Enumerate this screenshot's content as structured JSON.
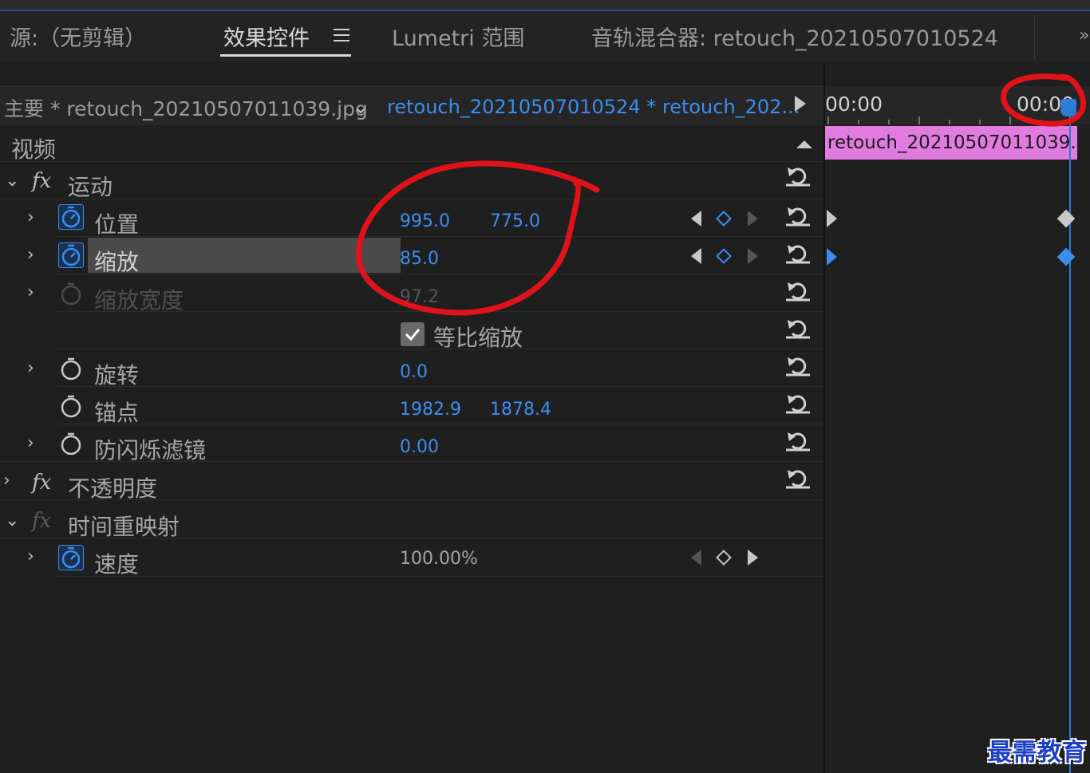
{
  "tabs": [
    {
      "label": "源:（无剪辑）"
    },
    {
      "label": "效果控件"
    },
    {
      "label": "Lumetri 范围"
    },
    {
      "label": "音轨混合器: retouch_20210507010524"
    }
  ],
  "clip_bar": {
    "master": "主要 * retouch_20210507011039.jpg",
    "sequence": "retouch_20210507010524 * retouch_202..."
  },
  "section": {
    "video": "视频"
  },
  "effects": {
    "motion": {
      "label": "运动",
      "position": {
        "label": "位置",
        "x": "995.0",
        "y": "775.0"
      },
      "scale": {
        "label": "缩放",
        "value": "85.0"
      },
      "scale_width": {
        "label": "缩放宽度",
        "value": "97.2"
      },
      "uniform_scale": {
        "label": "等比缩放",
        "checked": true
      },
      "rotation": {
        "label": "旋转",
        "value": "0.0"
      },
      "anchor": {
        "label": "锚点",
        "x": "1982.9",
        "y": "1878.4"
      },
      "anti_flicker": {
        "label": "防闪烁滤镜",
        "value": "0.00"
      }
    },
    "opacity": {
      "label": "不透明度"
    },
    "time_remap": {
      "label": "时间重映射",
      "speed": {
        "label": "速度",
        "value": "100.00%"
      }
    }
  },
  "timeline": {
    "start_time": "00:00",
    "end_time": "00:00",
    "clip_name": "retouch_20210507011039."
  },
  "watermark": "最需教育",
  "colors": {
    "accent_blue": "#3b8ef0",
    "clip_pink": "#e27be0",
    "annotation_red": "#e0121a",
    "panel_bg": "#1f1f1f"
  }
}
